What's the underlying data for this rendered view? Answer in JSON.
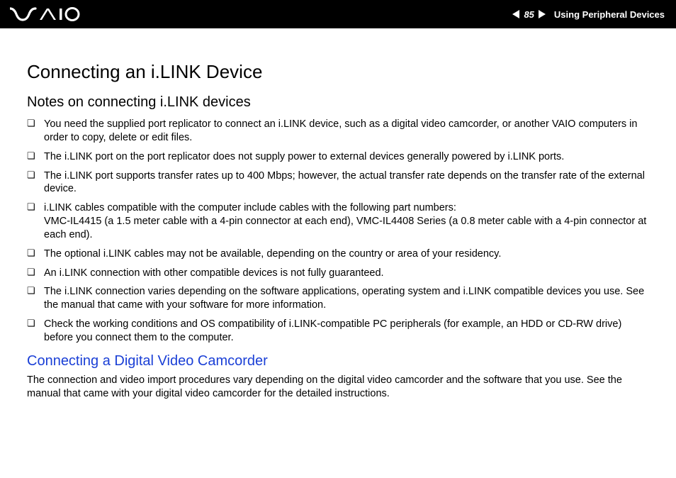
{
  "header": {
    "page_number": "85",
    "section": "Using Peripheral Devices",
    "logo_alt": "VAIO"
  },
  "page": {
    "title": "Connecting an i.LINK Device",
    "subtitle": "Notes on connecting i.LINK devices",
    "notes": [
      "You need the supplied port replicator to connect an i.LINK device, such as a digital video camcorder, or another VAIO computers in order to copy, delete or edit files.",
      "The i.LINK port on the port replicator does not supply power to external devices generally powered by i.LINK ports.",
      "The i.LINK port supports transfer rates up to 400 Mbps; however, the actual transfer rate depends on the transfer rate of the external device.",
      "i.LINK cables compatible with the computer include cables with the following part numbers:\nVMC-IL4415 (a 1.5 meter cable with a 4-pin connector at each end), VMC-IL4408 Series (a 0.8 meter cable with a 4-pin connector at each end).",
      "The optional i.LINK cables may not be available, depending on the country or area of your residency.",
      "An i.LINK connection with other compatible devices is not fully guaranteed.",
      "The i.LINK connection varies depending on the software applications, operating system and i.LINK compatible devices you use. See the manual that came with your software for more information.",
      "Check the working conditions and OS compatibility of i.LINK-compatible PC peripherals (for example, an HDD or CD-RW drive) before you connect them to the computer."
    ],
    "subsection_title": "Connecting a Digital Video Camcorder",
    "subsection_body": "The connection and video import procedures vary depending on the digital video camcorder and the software that you use. See the manual that came with your digital video camcorder for the detailed instructions."
  }
}
